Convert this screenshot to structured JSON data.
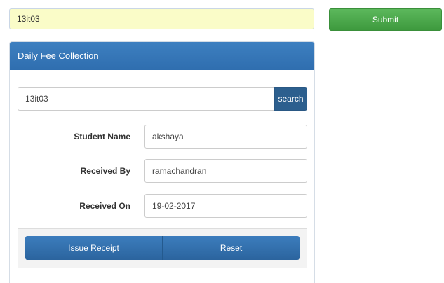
{
  "top_bar": {
    "input_value": "13it03",
    "submit_label": "Submit"
  },
  "panel": {
    "title": "Daily Fee Collection",
    "search": {
      "value": "13it03",
      "button_label": "search"
    },
    "fields": [
      {
        "label": "Student Name",
        "value": "akshaya"
      },
      {
        "label": "Received By",
        "value": "ramachandran"
      },
      {
        "label": "Received On",
        "value": "19-02-2017"
      }
    ],
    "actions": {
      "issue_label": "Issue Receipt",
      "reset_label": "Reset"
    }
  },
  "colors": {
    "panel_header": "#3d7fc0",
    "submit_green": "#5cb85c",
    "search_button": "#2c5f8e",
    "top_input_bg": "#fafcc8"
  }
}
